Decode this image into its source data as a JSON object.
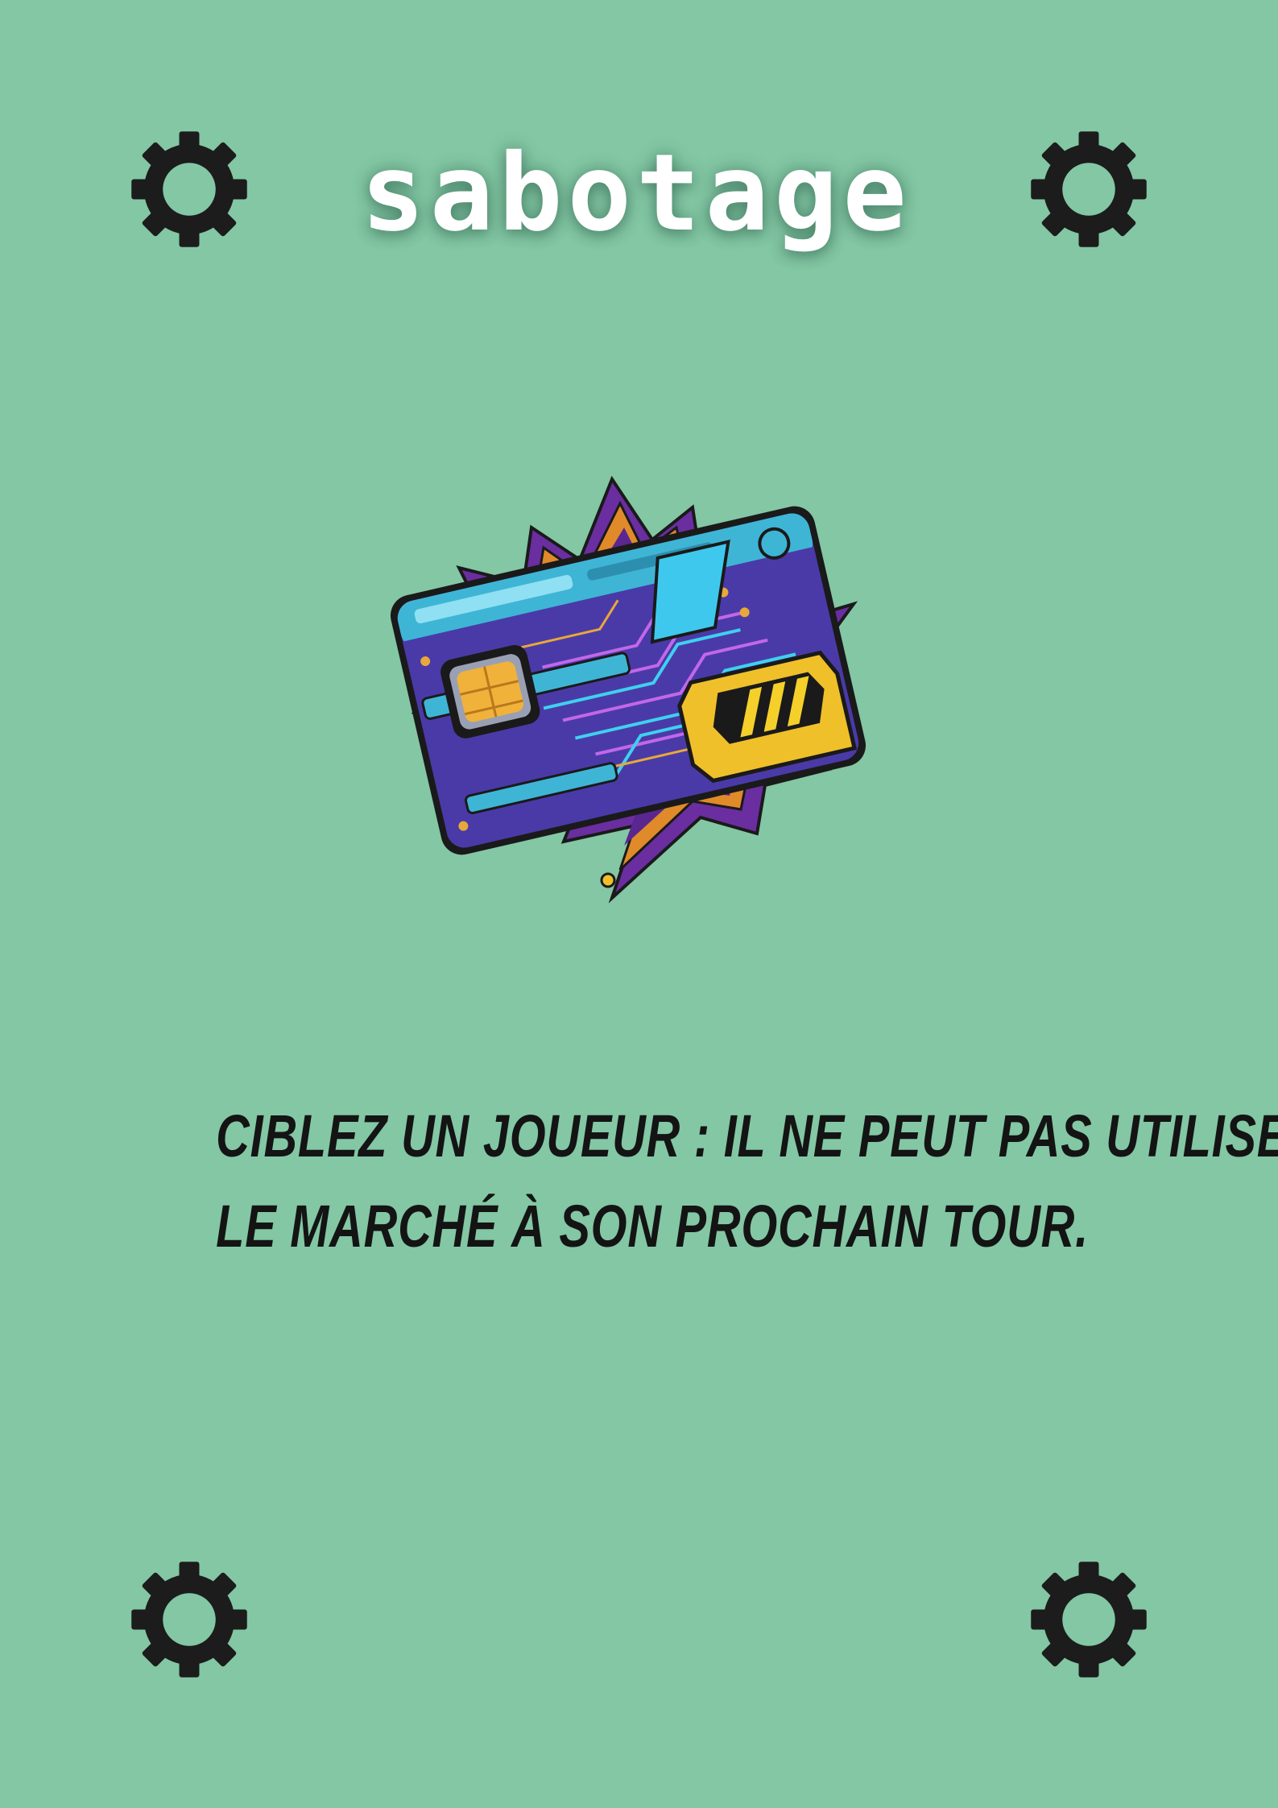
{
  "card": {
    "title": "SABOTAGE",
    "background_color": "#83c7a4",
    "illustration_icon": "cyber-keycard-icon",
    "corner_icon": "gear-icon",
    "ability_lines": [
      "CIBLEZ UN JOUEUR : IL NE PEUT PAS UTILISER",
      "LE MARCHÉ À SON PROCHAIN TOUR."
    ]
  }
}
